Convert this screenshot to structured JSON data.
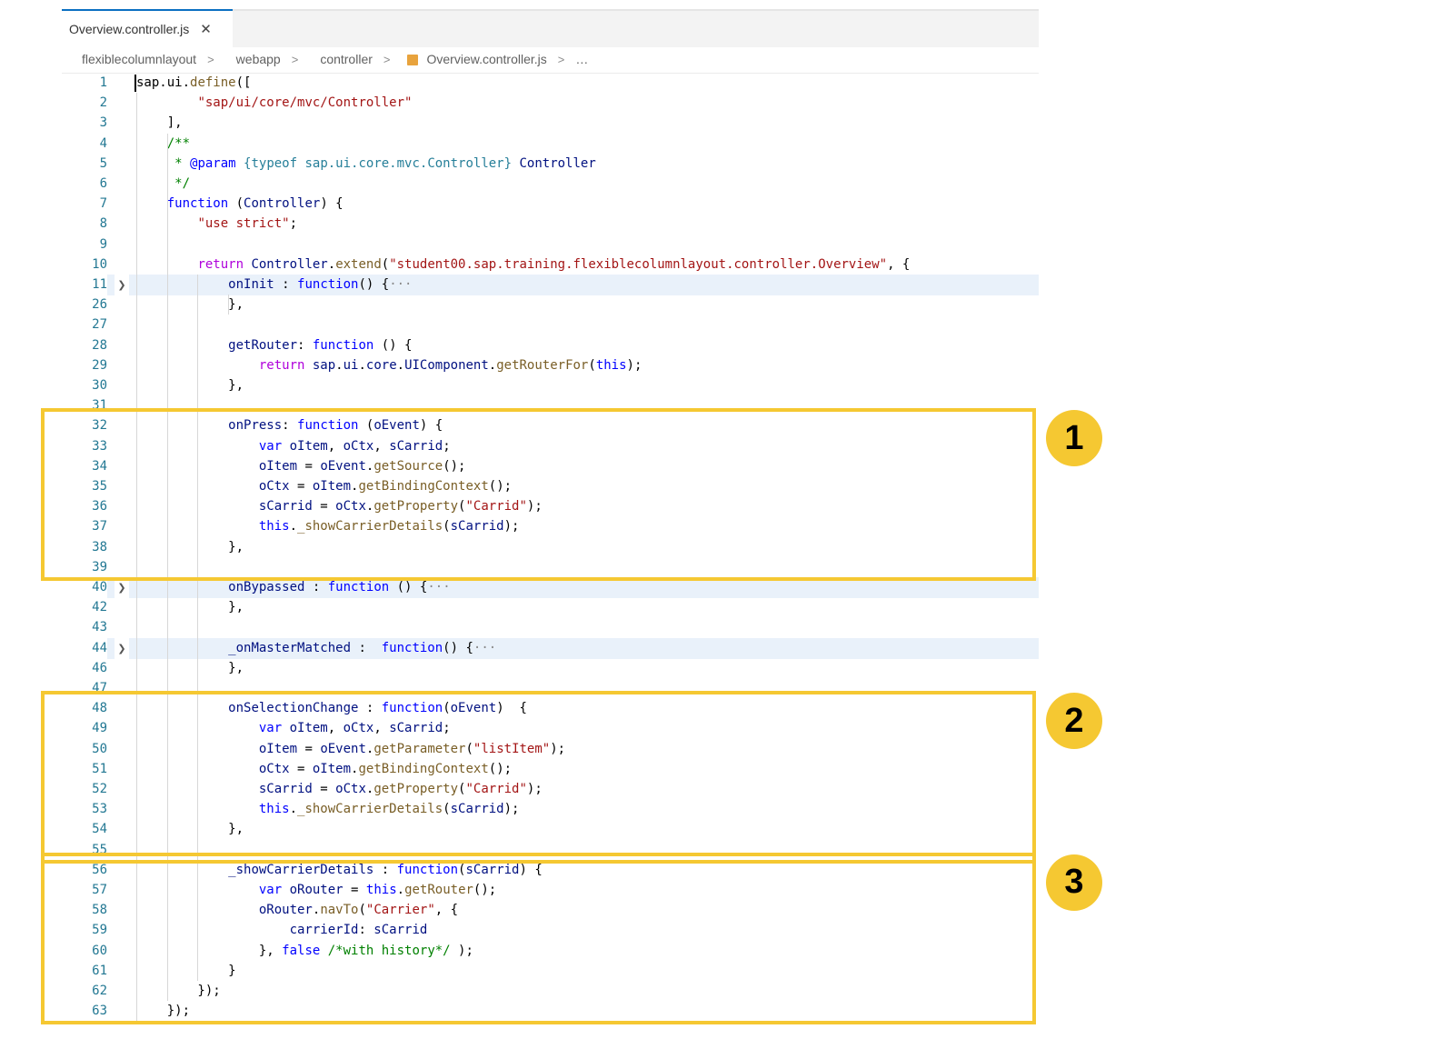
{
  "tab": {
    "title": "Overview.controller.js",
    "close_icon": "✕"
  },
  "breadcrumb": {
    "items": [
      "flexiblecolumnlayout",
      "webapp",
      "controller",
      "Overview.controller.js",
      "…"
    ]
  },
  "colors": {
    "keyword": "#0000ff",
    "control_keyword": "#af00db",
    "string": "#a31515",
    "comment": "#008000",
    "identifier": "#001080",
    "function_call": "#795e26",
    "type_name": "#267f99",
    "line_number": "#237893",
    "annotation_yellow": "#f5c832"
  },
  "code_lines": [
    {
      "n": "1",
      "folded": false,
      "tokens": [
        [
          "sap.ui.",
          "#000000"
        ],
        [
          "define",
          "#795e26"
        ],
        [
          "([",
          "#000000"
        ]
      ]
    },
    {
      "n": "2",
      "folded": false,
      "tokens": [
        [
          "        ",
          ""
        ],
        [
          "\"sap/ui/core/mvc/Controller\"",
          "#a31515"
        ]
      ]
    },
    {
      "n": "3",
      "folded": false,
      "tokens": [
        [
          "    ],",
          ""
        ]
      ]
    },
    {
      "n": "4",
      "folded": false,
      "tokens": [
        [
          "    ",
          ""
        ],
        [
          "/**",
          "#008000"
        ]
      ]
    },
    {
      "n": "5",
      "folded": false,
      "tokens": [
        [
          "     ",
          ""
        ],
        [
          "* ",
          "#008000"
        ],
        [
          "@param",
          "#0000ff"
        ],
        [
          " ",
          ""
        ],
        [
          "{typeof sap.ui.core.mvc.Controller}",
          "#267f99"
        ],
        [
          " ",
          ""
        ],
        [
          "Controller",
          "#001080"
        ]
      ]
    },
    {
      "n": "6",
      "folded": false,
      "tokens": [
        [
          "     ",
          ""
        ],
        [
          "*/",
          "#008000"
        ]
      ]
    },
    {
      "n": "7",
      "folded": false,
      "tokens": [
        [
          "    ",
          ""
        ],
        [
          "function",
          "#0000ff"
        ],
        [
          " (",
          ""
        ],
        [
          "Controller",
          "#001080"
        ],
        [
          ") {",
          ""
        ]
      ]
    },
    {
      "n": "8",
      "folded": false,
      "tokens": [
        [
          "        ",
          ""
        ],
        [
          "\"use strict\"",
          "#a31515"
        ],
        [
          ";",
          ""
        ]
      ]
    },
    {
      "n": "9",
      "folded": false,
      "tokens": []
    },
    {
      "n": "10",
      "folded": false,
      "tokens": [
        [
          "        ",
          ""
        ],
        [
          "return",
          "#af00db"
        ],
        [
          " ",
          ""
        ],
        [
          "Controller",
          "#001080"
        ],
        [
          ".",
          ""
        ],
        [
          "extend",
          "#795e26"
        ],
        [
          "(",
          ""
        ],
        [
          "\"student00.sap.training.flexiblecolumnlayout.controller.Overview\"",
          "#a31515"
        ],
        [
          ", {",
          ""
        ]
      ]
    },
    {
      "n": "11",
      "folded": true,
      "tokens": [
        [
          "            ",
          ""
        ],
        [
          "onInit",
          "#001080"
        ],
        [
          " : ",
          ""
        ],
        [
          "function",
          "#0000ff"
        ],
        [
          "() {",
          ""
        ],
        [
          "···",
          "#888888"
        ]
      ]
    },
    {
      "n": "26",
      "folded": false,
      "tokens": [
        [
          "            },",
          ""
        ]
      ]
    },
    {
      "n": "27",
      "folded": false,
      "tokens": []
    },
    {
      "n": "28",
      "folded": false,
      "tokens": [
        [
          "            ",
          ""
        ],
        [
          "getRouter",
          "#001080"
        ],
        [
          ": ",
          ""
        ],
        [
          "function",
          "#0000ff"
        ],
        [
          " () {",
          ""
        ]
      ]
    },
    {
      "n": "29",
      "folded": false,
      "tokens": [
        [
          "                ",
          ""
        ],
        [
          "return",
          "#af00db"
        ],
        [
          " ",
          ""
        ],
        [
          "sap",
          "#001080"
        ],
        [
          ".",
          ""
        ],
        [
          "ui",
          "#001080"
        ],
        [
          ".",
          ""
        ],
        [
          "core",
          "#001080"
        ],
        [
          ".",
          ""
        ],
        [
          "UIComponent",
          "#001080"
        ],
        [
          ".",
          ""
        ],
        [
          "getRouterFor",
          "#795e26"
        ],
        [
          "(",
          ""
        ],
        [
          "this",
          "#0000ff"
        ],
        [
          ");",
          ""
        ]
      ]
    },
    {
      "n": "30",
      "folded": false,
      "tokens": [
        [
          "            },",
          ""
        ]
      ]
    },
    {
      "n": "31",
      "folded": false,
      "tokens": []
    },
    {
      "n": "32",
      "folded": false,
      "tokens": [
        [
          "            ",
          ""
        ],
        [
          "onPress",
          "#001080"
        ],
        [
          ": ",
          ""
        ],
        [
          "function",
          "#0000ff"
        ],
        [
          " (",
          ""
        ],
        [
          "oEvent",
          "#001080"
        ],
        [
          ") {",
          ""
        ]
      ]
    },
    {
      "n": "33",
      "folded": false,
      "tokens": [
        [
          "                ",
          ""
        ],
        [
          "var",
          "#0000ff"
        ],
        [
          " ",
          ""
        ],
        [
          "oItem",
          "#001080"
        ],
        [
          ", ",
          ""
        ],
        [
          "oCtx",
          "#001080"
        ],
        [
          ", ",
          ""
        ],
        [
          "sCarrid",
          "#001080"
        ],
        [
          ";",
          ""
        ]
      ]
    },
    {
      "n": "34",
      "folded": false,
      "tokens": [
        [
          "                ",
          ""
        ],
        [
          "oItem",
          "#001080"
        ],
        [
          " = ",
          ""
        ],
        [
          "oEvent",
          "#001080"
        ],
        [
          ".",
          ""
        ],
        [
          "getSource",
          "#795e26"
        ],
        [
          "();",
          ""
        ]
      ]
    },
    {
      "n": "35",
      "folded": false,
      "tokens": [
        [
          "                ",
          ""
        ],
        [
          "oCtx",
          "#001080"
        ],
        [
          " = ",
          ""
        ],
        [
          "oItem",
          "#001080"
        ],
        [
          ".",
          ""
        ],
        [
          "getBindingContext",
          "#795e26"
        ],
        [
          "();",
          ""
        ]
      ]
    },
    {
      "n": "36",
      "folded": false,
      "tokens": [
        [
          "                ",
          ""
        ],
        [
          "sCarrid",
          "#001080"
        ],
        [
          " = ",
          ""
        ],
        [
          "oCtx",
          "#001080"
        ],
        [
          ".",
          ""
        ],
        [
          "getProperty",
          "#795e26"
        ],
        [
          "(",
          ""
        ],
        [
          "\"Carrid\"",
          "#a31515"
        ],
        [
          ");",
          ""
        ]
      ]
    },
    {
      "n": "37",
      "folded": false,
      "tokens": [
        [
          "                ",
          ""
        ],
        [
          "this",
          "#0000ff"
        ],
        [
          ".",
          ""
        ],
        [
          "_showCarrierDetails",
          "#795e26"
        ],
        [
          "(",
          ""
        ],
        [
          "sCarrid",
          "#001080"
        ],
        [
          ");",
          ""
        ]
      ]
    },
    {
      "n": "38",
      "folded": false,
      "tokens": [
        [
          "            },",
          ""
        ]
      ]
    },
    {
      "n": "39",
      "folded": false,
      "tokens": []
    },
    {
      "n": "40",
      "folded": true,
      "tokens": [
        [
          "            ",
          ""
        ],
        [
          "onBypassed",
          "#001080"
        ],
        [
          " : ",
          ""
        ],
        [
          "function",
          "#0000ff"
        ],
        [
          " () {",
          ""
        ],
        [
          "···",
          "#888888"
        ]
      ]
    },
    {
      "n": "42",
      "folded": false,
      "tokens": [
        [
          "            },",
          ""
        ]
      ]
    },
    {
      "n": "43",
      "folded": false,
      "tokens": []
    },
    {
      "n": "44",
      "folded": true,
      "tokens": [
        [
          "            ",
          ""
        ],
        [
          "_onMasterMatched",
          "#001080"
        ],
        [
          " :  ",
          ""
        ],
        [
          "function",
          "#0000ff"
        ],
        [
          "() {",
          ""
        ],
        [
          "···",
          "#888888"
        ]
      ]
    },
    {
      "n": "46",
      "folded": false,
      "tokens": [
        [
          "            },",
          ""
        ]
      ]
    },
    {
      "n": "47",
      "folded": false,
      "tokens": []
    },
    {
      "n": "48",
      "folded": false,
      "tokens": [
        [
          "            ",
          ""
        ],
        [
          "onSelectionChange",
          "#001080"
        ],
        [
          " : ",
          ""
        ],
        [
          "function",
          "#0000ff"
        ],
        [
          "(",
          ""
        ],
        [
          "oEvent",
          "#001080"
        ],
        [
          ")  {",
          ""
        ]
      ]
    },
    {
      "n": "49",
      "folded": false,
      "tokens": [
        [
          "                ",
          ""
        ],
        [
          "var",
          "#0000ff"
        ],
        [
          " ",
          ""
        ],
        [
          "oItem",
          "#001080"
        ],
        [
          ", ",
          ""
        ],
        [
          "oCtx",
          "#001080"
        ],
        [
          ", ",
          ""
        ],
        [
          "sCarrid",
          "#001080"
        ],
        [
          ";",
          ""
        ]
      ]
    },
    {
      "n": "50",
      "folded": false,
      "tokens": [
        [
          "                ",
          ""
        ],
        [
          "oItem",
          "#001080"
        ],
        [
          " = ",
          ""
        ],
        [
          "oEvent",
          "#001080"
        ],
        [
          ".",
          ""
        ],
        [
          "getParameter",
          "#795e26"
        ],
        [
          "(",
          ""
        ],
        [
          "\"listItem\"",
          "#a31515"
        ],
        [
          ");",
          ""
        ]
      ]
    },
    {
      "n": "51",
      "folded": false,
      "tokens": [
        [
          "                ",
          ""
        ],
        [
          "oCtx",
          "#001080"
        ],
        [
          " = ",
          ""
        ],
        [
          "oItem",
          "#001080"
        ],
        [
          ".",
          ""
        ],
        [
          "getBindingContext",
          "#795e26"
        ],
        [
          "();",
          ""
        ]
      ]
    },
    {
      "n": "52",
      "folded": false,
      "tokens": [
        [
          "                ",
          ""
        ],
        [
          "sCarrid",
          "#001080"
        ],
        [
          " = ",
          ""
        ],
        [
          "oCtx",
          "#001080"
        ],
        [
          ".",
          ""
        ],
        [
          "getProperty",
          "#795e26"
        ],
        [
          "(",
          ""
        ],
        [
          "\"Carrid\"",
          "#a31515"
        ],
        [
          ");",
          ""
        ]
      ]
    },
    {
      "n": "53",
      "folded": false,
      "tokens": [
        [
          "                ",
          ""
        ],
        [
          "this",
          "#0000ff"
        ],
        [
          ".",
          ""
        ],
        [
          "_showCarrierDetails",
          "#795e26"
        ],
        [
          "(",
          ""
        ],
        [
          "sCarrid",
          "#001080"
        ],
        [
          ");",
          ""
        ]
      ]
    },
    {
      "n": "54",
      "folded": false,
      "tokens": [
        [
          "            },",
          ""
        ]
      ]
    },
    {
      "n": "55",
      "folded": false,
      "tokens": []
    },
    {
      "n": "56",
      "folded": false,
      "tokens": [
        [
          "            ",
          ""
        ],
        [
          "_showCarrierDetails",
          "#001080"
        ],
        [
          " : ",
          ""
        ],
        [
          "function",
          "#0000ff"
        ],
        [
          "(",
          ""
        ],
        [
          "sCarrid",
          "#001080"
        ],
        [
          ") {",
          ""
        ]
      ]
    },
    {
      "n": "57",
      "folded": false,
      "tokens": [
        [
          "                ",
          ""
        ],
        [
          "var",
          "#0000ff"
        ],
        [
          " ",
          ""
        ],
        [
          "oRouter",
          "#001080"
        ],
        [
          " = ",
          ""
        ],
        [
          "this",
          "#0000ff"
        ],
        [
          ".",
          ""
        ],
        [
          "getRouter",
          "#795e26"
        ],
        [
          "();",
          ""
        ]
      ]
    },
    {
      "n": "58",
      "folded": false,
      "tokens": [
        [
          "                ",
          ""
        ],
        [
          "oRouter",
          "#001080"
        ],
        [
          ".",
          ""
        ],
        [
          "navTo",
          "#795e26"
        ],
        [
          "(",
          ""
        ],
        [
          "\"Carrier\"",
          "#a31515"
        ],
        [
          ", {",
          ""
        ]
      ]
    },
    {
      "n": "59",
      "folded": false,
      "tokens": [
        [
          "                    ",
          ""
        ],
        [
          "carrierId",
          "#001080"
        ],
        [
          ": ",
          ""
        ],
        [
          "sCarrid",
          "#001080"
        ]
      ]
    },
    {
      "n": "60",
      "folded": false,
      "tokens": [
        [
          "                }, ",
          ""
        ],
        [
          "false",
          "#0000ff"
        ],
        [
          " ",
          ""
        ],
        [
          "/*with history*/",
          "#008000"
        ],
        [
          " );",
          ""
        ]
      ]
    },
    {
      "n": "61",
      "folded": false,
      "tokens": [
        [
          "            }",
          ""
        ]
      ]
    },
    {
      "n": "62",
      "folded": false,
      "tokens": [
        [
          "        });",
          ""
        ]
      ]
    },
    {
      "n": "63",
      "folded": false,
      "tokens": [
        [
          "    });",
          ""
        ]
      ]
    }
  ],
  "annotations": [
    {
      "label": "1",
      "first_line": "32",
      "last_line": "39"
    },
    {
      "label": "2",
      "first_line": "48",
      "last_line": "55"
    },
    {
      "label": "3",
      "first_line": "56",
      "last_line": "63"
    }
  ]
}
